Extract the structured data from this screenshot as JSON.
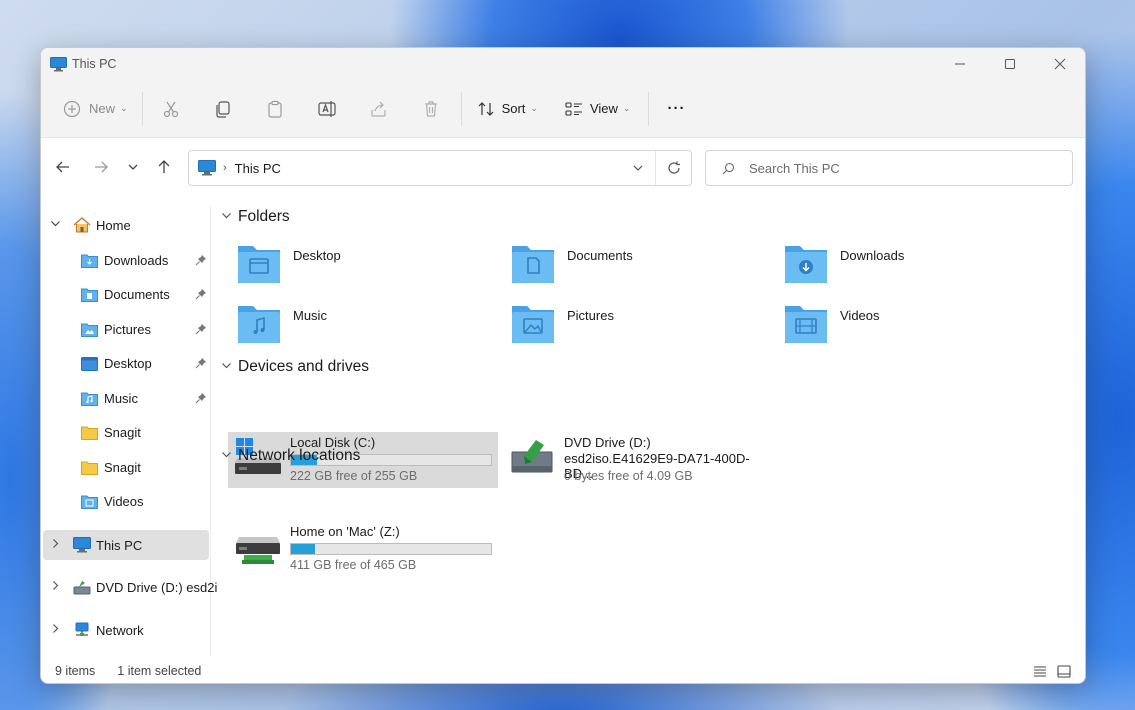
{
  "window": {
    "title": "This PC"
  },
  "toolbar": {
    "new_label": "New",
    "sort_label": "Sort",
    "view_label": "View",
    "more_label": "···"
  },
  "address": {
    "location": "This PC"
  },
  "search": {
    "placeholder": "Search This PC"
  },
  "sidebar": {
    "home": "Home",
    "quick_access": [
      {
        "label": "Downloads",
        "pinned": true
      },
      {
        "label": "Documents",
        "pinned": true
      },
      {
        "label": "Pictures",
        "pinned": true
      },
      {
        "label": "Desktop",
        "pinned": true
      },
      {
        "label": "Music",
        "pinned": true
      },
      {
        "label": "Snagit",
        "pinned": false
      },
      {
        "label": "Snagit",
        "pinned": false
      },
      {
        "label": "Videos",
        "pinned": false
      }
    ],
    "this_pc": "This PC",
    "dvd": "DVD Drive (D:) esd2i",
    "network": "Network"
  },
  "sections": {
    "folders": "Folders",
    "devices": "Devices and drives",
    "network": "Network locations"
  },
  "folders": [
    {
      "name": "Desktop",
      "icon": "desktop-folder-icon"
    },
    {
      "name": "Documents",
      "icon": "documents-folder-icon"
    },
    {
      "name": "Downloads",
      "icon": "downloads-folder-icon"
    },
    {
      "name": "Music",
      "icon": "music-folder-icon"
    },
    {
      "name": "Pictures",
      "icon": "pictures-folder-icon"
    },
    {
      "name": "Videos",
      "icon": "videos-folder-icon"
    }
  ],
  "drives": [
    {
      "name": "Local Disk (C:)",
      "free": "222 GB free of 255 GB",
      "used_fraction": 0.13,
      "selected": true
    },
    {
      "name": "DVD Drive (D:)",
      "label": "esd2iso.E41629E9-DA71-400D-BD...",
      "free": "0 bytes free of 4.09 GB"
    }
  ],
  "network_locations": [
    {
      "name": "Home on 'Mac' (Z:)",
      "free": "411 GB free of 465 GB",
      "used_fraction": 0.12
    }
  ],
  "status": {
    "items": "9 items",
    "selected": "1 item selected"
  },
  "colors": {
    "accent": "#26a0da",
    "folder": "#5fb2ea",
    "selection": "#dadada"
  }
}
